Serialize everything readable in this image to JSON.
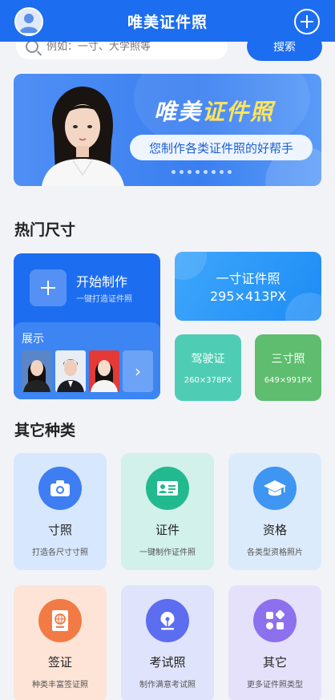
{
  "header": {
    "title": "唯美证件照",
    "avatar_icon": "user-avatar-icon",
    "add_icon": "plus-circle-icon"
  },
  "search": {
    "placeholder": "例如：一寸、大学照等",
    "button_label": "搜索"
  },
  "banner": {
    "title_part1": "唯美",
    "title_part2": "证件照",
    "subtitle": "您制作各类证件照的好帮手",
    "accent_color": "#ffe45c"
  },
  "hot_sizes": {
    "section_title": "热门尺寸",
    "start": {
      "title": "开始制作",
      "subtitle": "一键打造证件照",
      "showcase_label": "展示"
    },
    "one_inch": {
      "title": "一寸证件照",
      "size": "295×413PX"
    },
    "driver": {
      "title": "驾驶证",
      "size": "260×378PX",
      "color": "#4ecdb4"
    },
    "three_inch": {
      "title": "三寸照",
      "size": "649×991PX",
      "color": "#5ebd6e"
    }
  },
  "other_types": {
    "section_title": "其它种类",
    "items": [
      {
        "name": "寸照",
        "desc": "打造各尺寸寸照",
        "icon": "camera-icon",
        "bg": "#d7e7fd",
        "circle": "#3e7ef2"
      },
      {
        "name": "证件",
        "desc": "一键制作证件照",
        "icon": "id-card-icon",
        "bg": "#d2f1ea",
        "circle": "#22b98f"
      },
      {
        "name": "资格",
        "desc": "各类型资格照片",
        "icon": "graduation-cap-icon",
        "bg": "#dcebfb",
        "circle": "#3e95f2"
      },
      {
        "name": "签证",
        "desc": "种类丰富签证照",
        "icon": "passport-icon",
        "bg": "#fde4d6",
        "circle": "#f27b45"
      },
      {
        "name": "考试照",
        "desc": "制作满意考试照",
        "icon": "pen-nib-icon",
        "bg": "#dfe3fb",
        "circle": "#5c6df0"
      },
      {
        "name": "其它",
        "desc": "更多证件照类型",
        "icon": "apps-icon",
        "bg": "#e6e1fb",
        "circle": "#8c70ee"
      }
    ]
  }
}
